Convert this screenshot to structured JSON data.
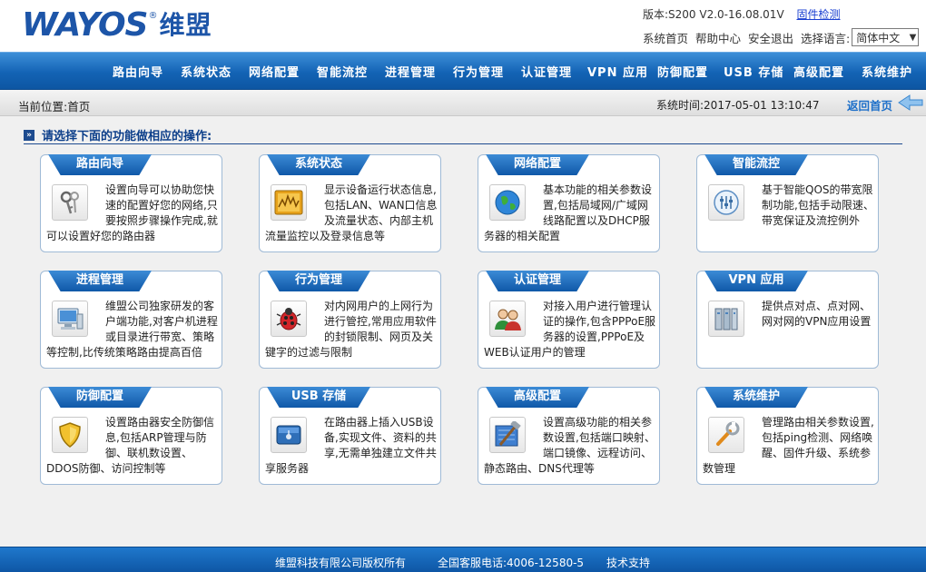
{
  "header": {
    "logo_text": "WAYOS",
    "logo_reg": "®",
    "logo_cn": "维盟",
    "version_label": "版本:S200 V2.0-16.08.01V",
    "firmware_check": "固件检测",
    "links": [
      "系统首页",
      "帮助中心",
      "安全退出"
    ],
    "language_label": "选择语言:",
    "language_value": "简体中文"
  },
  "nav": {
    "items": [
      "路由向导",
      "系统状态",
      "网络配置",
      "智能流控",
      "进程管理",
      "行为管理",
      "认证管理",
      "VPN 应用",
      "防御配置",
      "USB 存储",
      "高级配置",
      "系统维护"
    ]
  },
  "breadcrumb": {
    "location": "当前位置:首页",
    "system_time": "系统时间:2017-05-01 13:10:47",
    "back_home": "返回首页"
  },
  "main": {
    "section_title": "请选择下面的功能做相应的操作:",
    "cards": [
      {
        "title": "路由向导",
        "icon": "keys-icon",
        "desc": "设置向导可以协助您快速的配置好您的网络,只要按照步骤操作完成,就可以设置好您的路由器"
      },
      {
        "title": "系统状态",
        "icon": "chart-icon",
        "desc": "显示设备运行状态信息,包括LAN、WAN口信息及流量状态、内部主机流量监控以及登录信息等"
      },
      {
        "title": "网络配置",
        "icon": "globe-icon",
        "desc": "基本功能的相关参数设置,包括局域网/广域网线路配置以及DHCP服务器的相关配置"
      },
      {
        "title": "智能流控",
        "icon": "flow-control-icon",
        "desc": "基于智能QOS的带宽限制功能,包括手动限速、带宽保证及流控例外"
      },
      {
        "title": "进程管理",
        "icon": "computer-icon",
        "desc": "维盟公司独家研发的客户端功能,对客户机进程或目录进行带宽、策略等控制,比传统策略路由提高百倍"
      },
      {
        "title": "行为管理",
        "icon": "bug-icon",
        "desc": "对内网用户的上网行为进行管控,常用应用软件的封锁限制、网页及关键字的过滤与限制"
      },
      {
        "title": "认证管理",
        "icon": "users-icon",
        "desc": "对接入用户进行管理认证的操作,包含PPPoE服务器的设置,PPPoE及WEB认证用户的管理"
      },
      {
        "title": "VPN 应用",
        "icon": "server-icon",
        "desc": "提供点对点、点对网、网对网的VPN应用设置"
      },
      {
        "title": "防御配置",
        "icon": "shield-icon",
        "desc": "设置路由器安全防御信息,包括ARP管理与防御、联机数设置、DDOS防御、访问控制等"
      },
      {
        "title": "USB 存储",
        "icon": "usb-drive-icon",
        "desc": "在路由器上插入USB设备,实现文件、资料的共享,无需单独建立文件共享服务器"
      },
      {
        "title": "高级配置",
        "icon": "tools-icon",
        "desc": "设置高级功能的相关参数设置,包括端口映射、端口镜像、远程访问、静态路由、DNS代理等"
      },
      {
        "title": "系统维护",
        "icon": "wrench-icon",
        "desc": "管理路由相关参数设置,包括ping检测、网络唤醒、固件升级、系统参数管理"
      }
    ]
  },
  "footer": {
    "copyright": "维盟科技有限公司版权所有",
    "hotline": "全国客服电话:4006-12580-5",
    "support": "技术支持"
  },
  "colors": {
    "nav_blue": "#1363b5",
    "accent": "#1d6fc9",
    "title_blue": "#0d3f8a"
  }
}
